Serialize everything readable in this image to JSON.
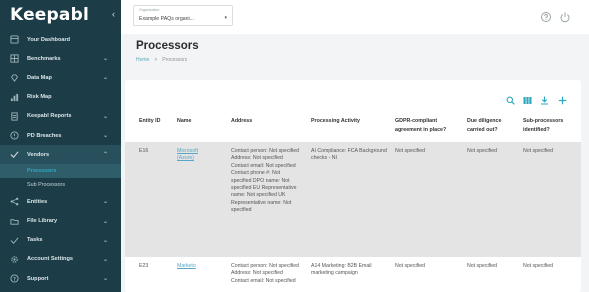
{
  "sidebar": {
    "logo": "Keepabl",
    "collapse_icon": "chevron-left-icon",
    "items": [
      {
        "label": "Your Dashboard",
        "icon": "dashboard-icon",
        "chevron": ""
      },
      {
        "label": "Benchmarks",
        "icon": "grid-icon",
        "chevron": "⌄"
      },
      {
        "label": "Data Map",
        "icon": "map-pin-icon",
        "chevron": "⌄"
      },
      {
        "label": "Risk Map",
        "icon": "bar-chart-icon",
        "chevron": ""
      },
      {
        "label": "Keepabl Reports",
        "icon": "report-icon",
        "chevron": "⌄"
      },
      {
        "label": "PD Breaches",
        "icon": "alert-icon",
        "chevron": "⌄"
      },
      {
        "label": "Vendors",
        "icon": "check-icon",
        "chevron": "⌃"
      },
      {
        "label": "Entities",
        "icon": "share-icon",
        "chevron": "⌄"
      },
      {
        "label": "File Library",
        "icon": "folder-icon",
        "chevron": "⌄"
      },
      {
        "label": "Tasks",
        "icon": "task-icon",
        "chevron": "⌄"
      },
      {
        "label": "Account Settings",
        "icon": "gear-icon",
        "chevron": "⌄"
      },
      {
        "label": "Support",
        "icon": "help-icon",
        "chevron": "⌄"
      }
    ],
    "sub_items": [
      {
        "label": "Processors"
      },
      {
        "label": "Sub Processors"
      }
    ]
  },
  "topbar": {
    "org_label": "Organisation",
    "org_value": "Example PAQs organi...",
    "org_caret": "▾",
    "icons": [
      "help-icon",
      "power-icon"
    ]
  },
  "header": {
    "title": "Processors",
    "breadcrumb": [
      "Home",
      ">",
      "Processors"
    ]
  },
  "toolbar": {
    "icons": [
      "search-icon",
      "columns-icon",
      "download-icon",
      "add-icon"
    ]
  },
  "table": {
    "headers": [
      "Entity ID",
      "Name",
      "Address",
      "Processing Activity",
      "GDPR-compliant agreement in place?",
      "Due diligence carried out?",
      "Sub-processors identified?"
    ],
    "rows": [
      {
        "id": "E16",
        "name": "Microsoft (Azure)",
        "address": "Contact person: Not specified Address: Not specified Contact email: Not specified Contact phone #: Not specified DPO name: Not specified EU Representative name: Not specified UK Representative name: Not specified",
        "activity": "AI Compliance: FCA Background checks - NI",
        "gdpr": "Not specified",
        "due": "Not specified",
        "sub": "Not specified"
      },
      {
        "id": "E23",
        "name": "Marketo",
        "address": "Contact person: Not specified Address: Not specified Contact email: Not specified",
        "activity": "A14 Marketing: B2B Email marketing campaign",
        "gdpr": "Not specified",
        "due": "Not specified",
        "sub": "Not specified"
      }
    ]
  },
  "colors": {
    "sidebar_bg": "#1c3d47",
    "accent": "#2ea7c0",
    "link": "#5aa6c6",
    "highlight_row": "#e4e4e4"
  }
}
